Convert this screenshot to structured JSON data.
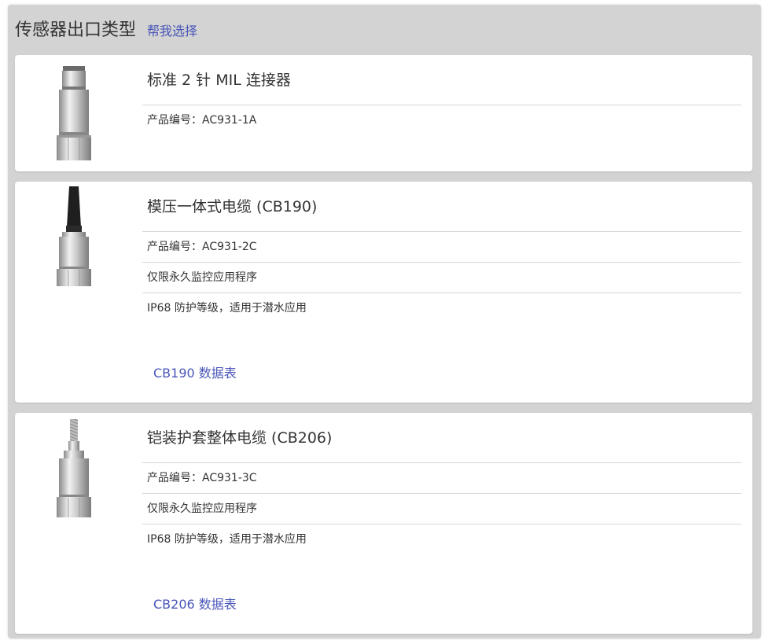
{
  "header": {
    "title": "传感器出口类型",
    "help_link": "帮我选择"
  },
  "cards": [
    {
      "title": "标准 2 针 MIL 连接器",
      "rows": [
        "产品编号：AC931-1A"
      ],
      "icon": "mil-connector-sensor-image"
    },
    {
      "title": "模压一体式电缆 (CB190)",
      "rows": [
        "产品编号：AC931-2C",
        "仅限永久监控应用程序",
        "IP68 防护等级，适用于潜水应用"
      ],
      "link": "CB190 数据表",
      "icon": "molded-cable-sensor-image"
    },
    {
      "title": "铠装护套整体电缆 (CB206)",
      "rows": [
        "产品编号：AC931-3C",
        "仅限永久监控应用程序",
        "IP68 防护等级，适用于潜水应用"
      ],
      "link": "CB206 数据表",
      "icon": "armored-cable-sensor-image"
    }
  ],
  "colors": {
    "panel_bg": "#d3d3d3",
    "link": "#4a56b8",
    "text": "#333333"
  }
}
